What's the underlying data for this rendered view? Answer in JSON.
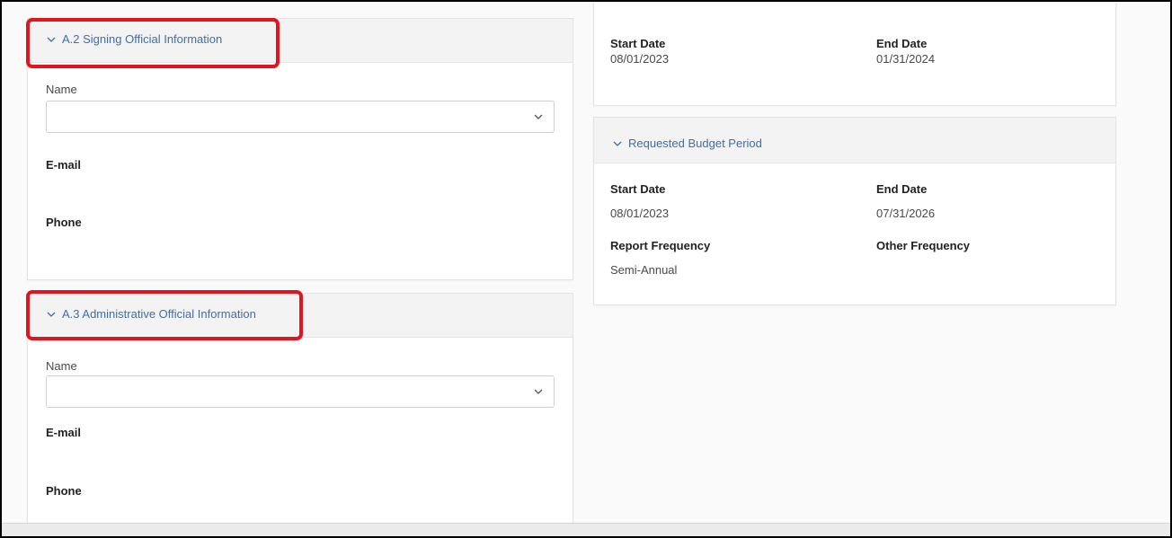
{
  "signing_section": {
    "title": "A.2 Signing Official Information",
    "name_label": "Name",
    "name_value": "",
    "email_label": "E-mail",
    "phone_label": "Phone"
  },
  "admin_section": {
    "title": "A.3 Administrative Official Information",
    "name_label": "Name",
    "name_value": "",
    "email_label": "E-mail",
    "phone_label": "Phone"
  },
  "project_period": {
    "start_label": "Start Date",
    "start_value": "08/01/2023",
    "end_label": "End Date",
    "end_value": "01/31/2024"
  },
  "budget_period": {
    "title": "Requested Budget Period",
    "start_label": "Start Date",
    "start_value": "08/01/2023",
    "end_label": "End Date",
    "end_value": "07/31/2026",
    "report_freq_label": "Report Frequency",
    "report_freq_value": "Semi-Annual",
    "other_freq_label": "Other Frequency"
  },
  "colors": {
    "section_link": "#3e6fa8",
    "highlight": "#e3141b"
  },
  "icons": [
    "chevron-down-icon",
    "dropdown-caret-icon"
  ]
}
